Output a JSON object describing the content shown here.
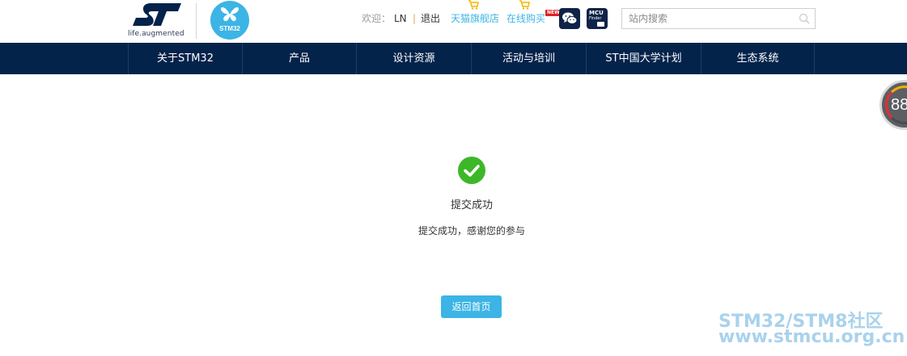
{
  "header": {
    "st_tagline": "life.augmented",
    "stm32_badge": "STM32",
    "welcome_label": "欢迎：",
    "username": "LN",
    "separator": "|",
    "logout": "退出",
    "tmall_store": "天猫旗舰店",
    "online_shop": "在线购买",
    "new_badge": "NEW",
    "mcu_finder_line1": "MCU",
    "mcu_finder_line2": "Finder",
    "search_placeholder": "站内搜索"
  },
  "nav": {
    "items": [
      {
        "label": "关于STM32"
      },
      {
        "label": "产品"
      },
      {
        "label": "设计资源"
      },
      {
        "label": "活动与培训"
      },
      {
        "label": "ST中国大学计划"
      },
      {
        "label": "生态系统"
      }
    ]
  },
  "floater": {
    "value": "88"
  },
  "main": {
    "success_title": "提交成功",
    "success_message": "提交成功，感谢您的参与",
    "home_button": "返回首页"
  },
  "watermark": {
    "line1": "STM32/STM8社区",
    "line2": "www.stmcu.org.cn"
  },
  "colors": {
    "navbar": "#03234b",
    "accent": "#3cb4e5",
    "success": "#3cb728"
  }
}
